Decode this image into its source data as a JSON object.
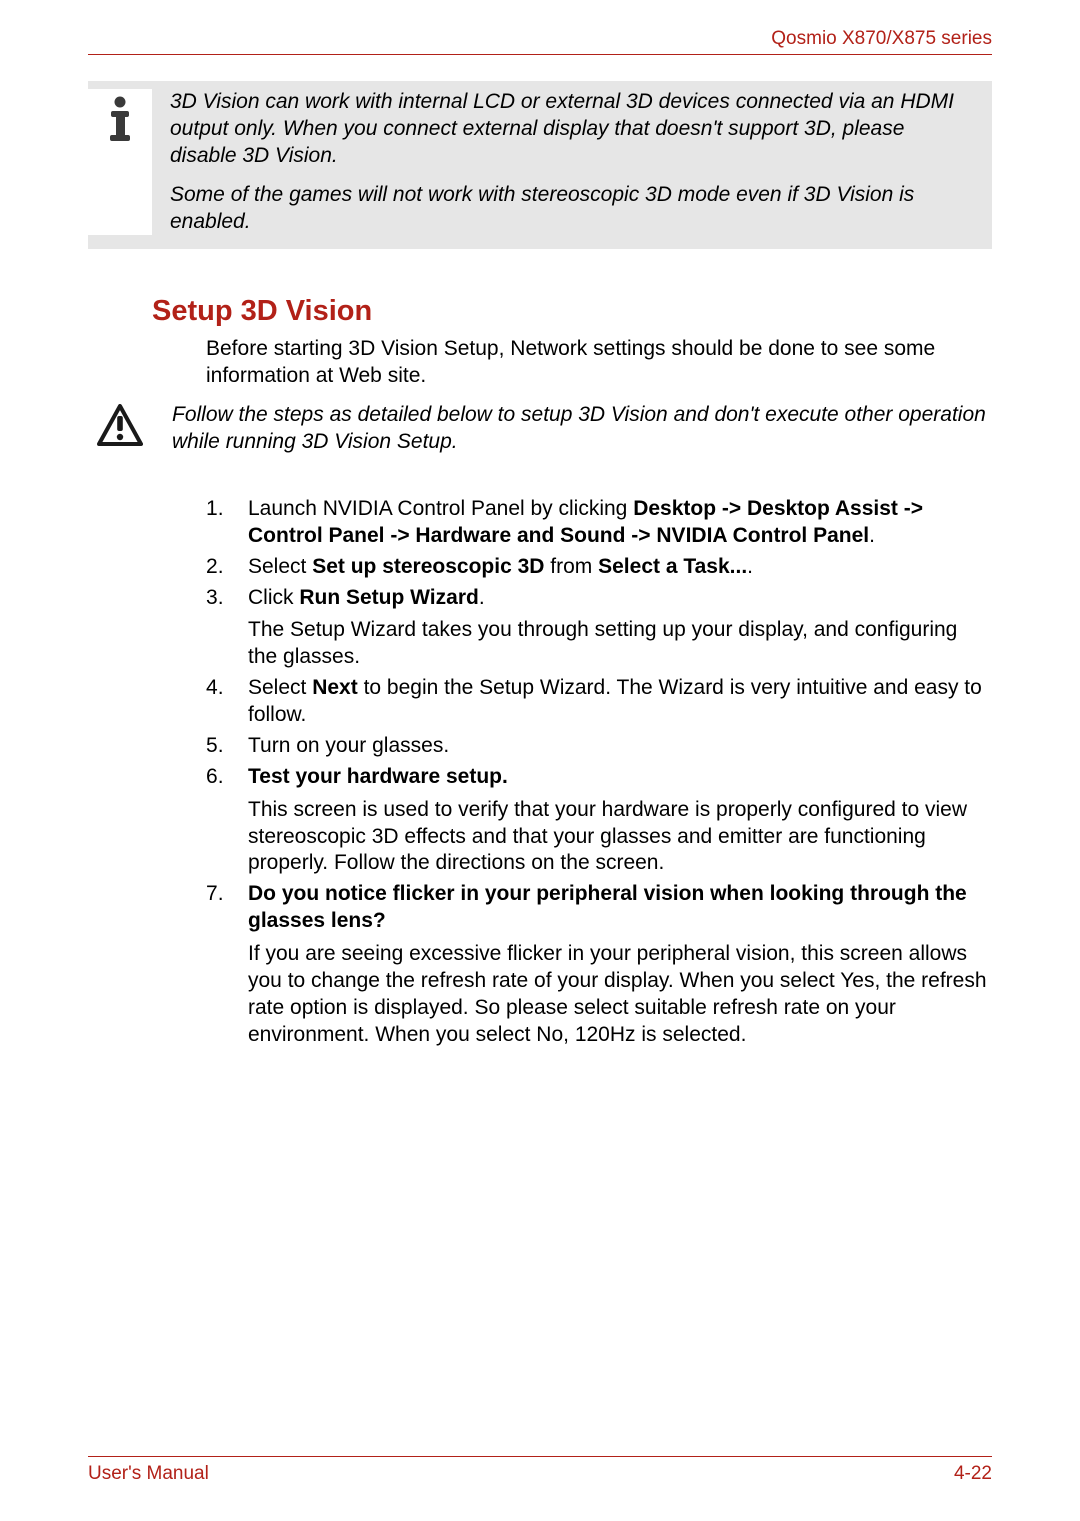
{
  "header": {
    "product_line": "Qosmio X870/X875 series"
  },
  "note_box": {
    "p1": "3D Vision can work with internal LCD or external 3D devices connected via an HDMI output only. When you connect external display that doesn't support 3D, please disable 3D Vision.",
    "p2": "Some of the games will not work with stereoscopic 3D mode even if 3D Vision is enabled."
  },
  "section_heading": "Setup 3D Vision",
  "intro_text": "Before starting 3D Vision Setup, Network settings should be done to see some information at Web site.",
  "caution_text": "Follow the steps as detailed below to setup 3D Vision and don't execute other operation while running 3D Vision Setup.",
  "steps": {
    "s1_a": "Launch NVIDIA Control Panel by clicking ",
    "s1_b": "Desktop -> Desktop Assist -> Control Panel -> Hardware and Sound -> NVIDIA Control Panel",
    "s1_c": ".",
    "s2_a": "Select ",
    "s2_b": "Set up stereoscopic 3D",
    "s2_c": " from ",
    "s2_d": "Select a Task...",
    "s2_e": ".",
    "s3_a": "Click ",
    "s3_b": "Run Setup Wizard",
    "s3_c": ".",
    "s3_sub": "The Setup Wizard takes you through setting up your display, and configuring the glasses.",
    "s4_a": "Select ",
    "s4_b": "Next",
    "s4_c": " to begin the Setup Wizard. The Wizard is very intuitive and easy to follow.",
    "s5": "Turn on your glasses.",
    "s6_b": "Test your hardware setup.",
    "s6_sub": "This screen is used to verify that your hardware is properly configured to view stereoscopic 3D effects and that your glasses and emitter are functioning properly. Follow the directions on the screen.",
    "s7_b": "Do you notice flicker in your peripheral vision when looking through the glasses lens?",
    "s7_sub": "If you are seeing excessive flicker in your peripheral vision, this screen allows you to change the refresh rate of your display. When you select Yes, the refresh rate option is displayed. So please select suitable refresh rate on your environment. When you select No, 120Hz is selected."
  },
  "footer": {
    "left": "User's Manual",
    "right": "4-22"
  }
}
